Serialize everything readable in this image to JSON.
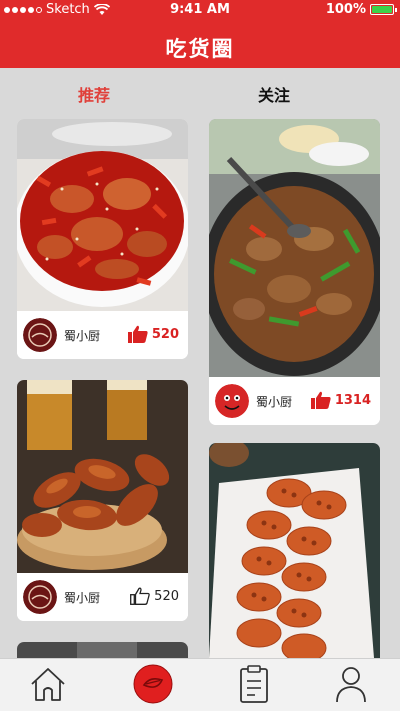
{
  "status_bar": {
    "carrier": "Sketch",
    "time": "9:41 AM",
    "battery": "100%"
  },
  "header": {
    "title": "吃货圈"
  },
  "tabs": [
    {
      "label": "推荐",
      "active": true
    },
    {
      "label": "关注",
      "active": false
    }
  ],
  "cards": [
    {
      "author": "蜀小厨",
      "likes": "520",
      "liked": true
    },
    {
      "author": "蜀小厨",
      "likes": "1314",
      "liked": true
    },
    {
      "author": "蜀小厨",
      "likes": "520",
      "liked": false
    }
  ],
  "tabbar": [
    {
      "icon": "home-icon"
    },
    {
      "icon": "discover-icon",
      "active": true
    },
    {
      "icon": "clipboard-icon"
    },
    {
      "icon": "user-icon"
    }
  ],
  "colors": {
    "brand": "#e02b2b",
    "accent": "#e0403a",
    "like": "#d92222"
  }
}
